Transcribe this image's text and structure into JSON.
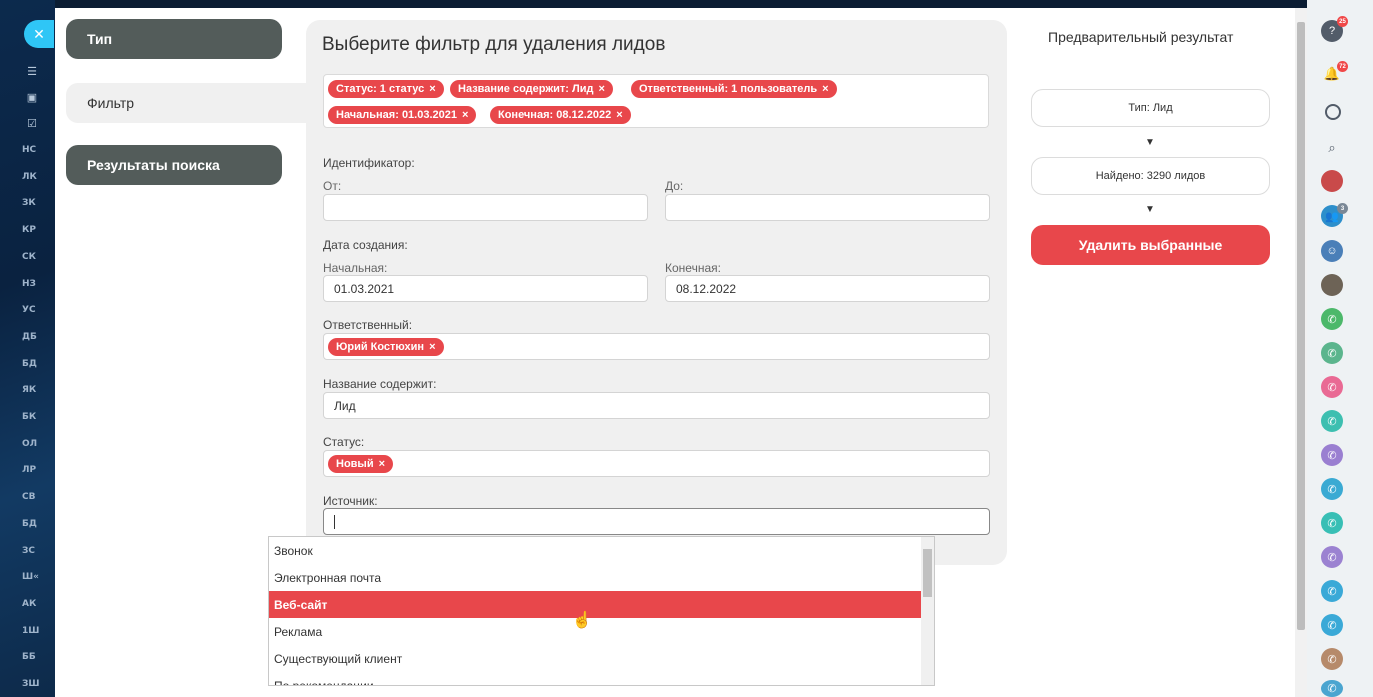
{
  "left_nav": {
    "abbreviations": [
      "НС",
      "ЛК",
      "ЗК",
      "КР",
      "СК",
      "НЗ",
      "УС",
      "ДБ",
      "БД",
      "ЯК",
      "БК",
      "ОЛ",
      "ЛР",
      "СВ",
      "БД",
      "ЗС",
      "Ш«",
      "АК",
      "1Ш",
      "ББ",
      "ЗШ"
    ]
  },
  "tabs": {
    "type": "Тип",
    "filter": "Фильтр",
    "results": "Результаты поиска"
  },
  "panel": {
    "title": "Выберите фильтр для удаления лидов",
    "chips": [
      {
        "label": "Статус: 1 статус"
      },
      {
        "label": "Название содержит: Лид"
      },
      {
        "label": "Ответственный: 1 пользователь"
      },
      {
        "label": "Начальная: 01.03.2021"
      },
      {
        "label": "Конечная: 08.12.2022"
      }
    ],
    "chip_close": "×",
    "id_label": "Идентификатор:",
    "from_label": "От:",
    "to_label": "До:",
    "from_value": "",
    "to_value": "",
    "date_label": "Дата создания:",
    "start_label": "Начальная:",
    "end_label": "Конечная:",
    "start_value": "01.03.2021",
    "end_value": "08.12.2022",
    "responsible_label": "Ответственный:",
    "responsible_chip": "Юрий Костюхин",
    "name_label": "Название содержит:",
    "name_value": "Лид",
    "status_label": "Статус:",
    "status_chip": "Новый",
    "source_label": "Источник:",
    "source_value": ""
  },
  "dropdown": {
    "options": [
      "Звонок",
      "Электронная почта",
      "Веб-сайт",
      "Реклама",
      "Существующий клиент",
      "По рекомендации"
    ],
    "selected": "Веб-сайт"
  },
  "result": {
    "title": "Предварительный результат",
    "type_box": "Тип: Лид",
    "found_box": "Найдено: 3290 лидов",
    "arrow": "▼",
    "delete_button": "Удалить выбранные"
  },
  "right_bar": {
    "help_badge": "25",
    "bell_badge": "72",
    "group_badge": "3"
  },
  "colors": {
    "accent": "#e8474b",
    "tab_dark": "#535c5a",
    "panel_bg": "#f0f0f0",
    "nav_bg": "#0c2a4d"
  }
}
